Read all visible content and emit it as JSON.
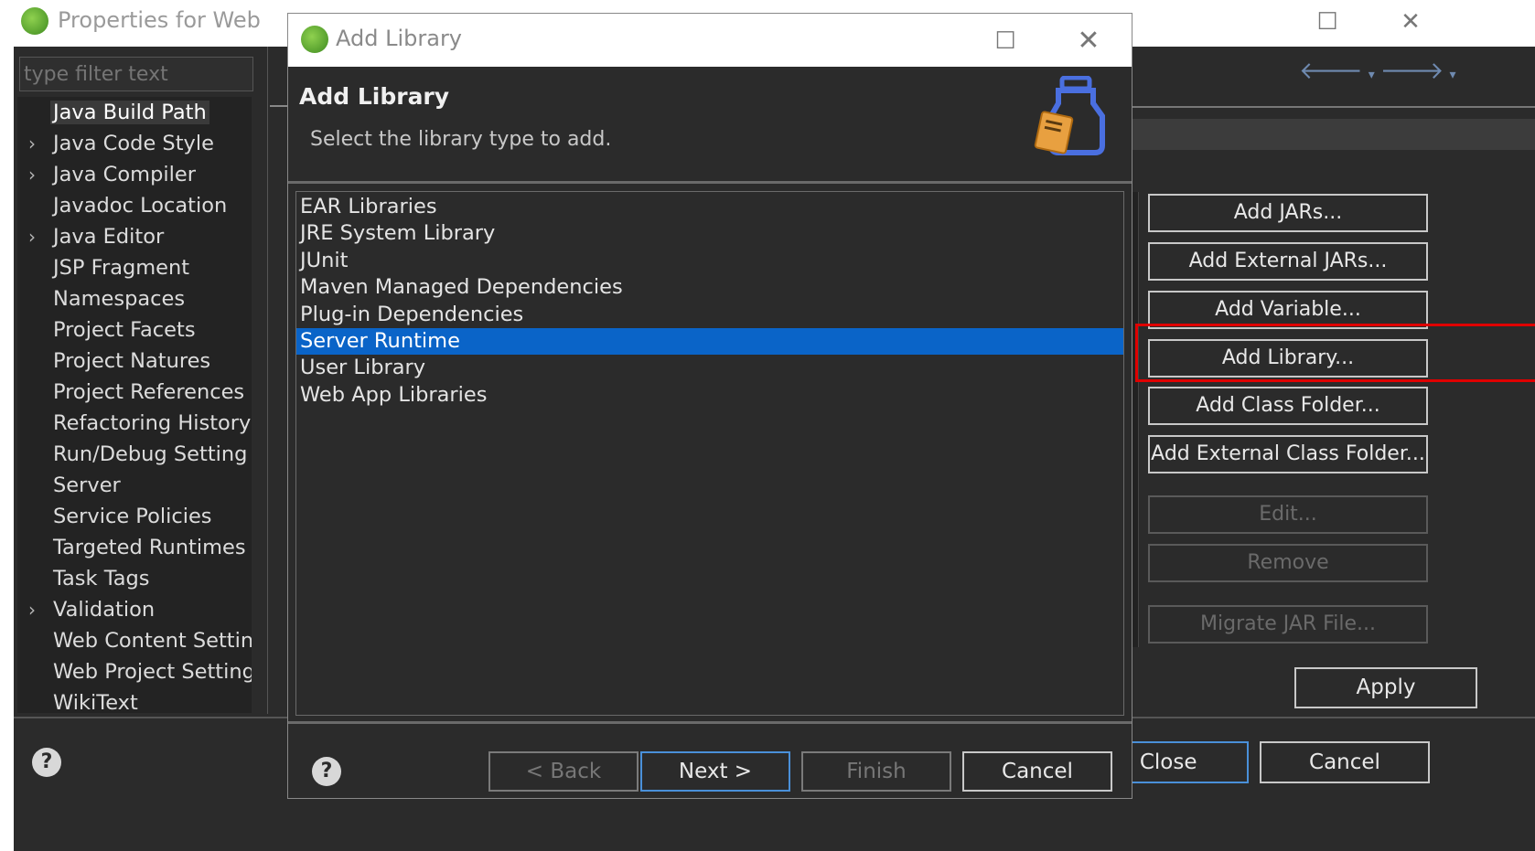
{
  "background_window": {
    "title": "Properties for Web",
    "filter": {
      "placeholder": "type filter text"
    },
    "tree_items": [
      {
        "label": "Java Build Path",
        "expandable": false,
        "selected": true
      },
      {
        "label": "Java Code Style",
        "expandable": true
      },
      {
        "label": "Java Compiler",
        "expandable": true
      },
      {
        "label": "Javadoc Location",
        "expandable": false
      },
      {
        "label": "Java Editor",
        "expandable": true
      },
      {
        "label": "JSP Fragment",
        "expandable": false
      },
      {
        "label": "Namespaces",
        "expandable": false
      },
      {
        "label": "Project Facets",
        "expandable": false
      },
      {
        "label": "Project Natures",
        "expandable": false
      },
      {
        "label": "Project References",
        "expandable": false
      },
      {
        "label": "Refactoring History",
        "expandable": false
      },
      {
        "label": "Run/Debug Setting",
        "expandable": false
      },
      {
        "label": "Server",
        "expandable": false
      },
      {
        "label": "Service Policies",
        "expandable": false
      },
      {
        "label": "Targeted Runtimes",
        "expandable": false
      },
      {
        "label": "Task Tags",
        "expandable": false
      },
      {
        "label": "Validation",
        "expandable": true
      },
      {
        "label": "Web Content Settin",
        "expandable": false
      },
      {
        "label": "Web Project Setting",
        "expandable": false
      },
      {
        "label": "WikiText",
        "expandable": false
      }
    ],
    "side_buttons": [
      {
        "label": "Add JARs...",
        "enabled": true
      },
      {
        "label": "Add External JARs...",
        "enabled": true
      },
      {
        "label": "Add Variable...",
        "enabled": true
      },
      {
        "label": "Add Library...",
        "enabled": true,
        "highlighted": true
      },
      {
        "label": "Add Class Folder...",
        "enabled": true
      },
      {
        "label": "Add External Class Folder...",
        "enabled": true
      },
      {
        "label": "Edit...",
        "enabled": false
      },
      {
        "label": "Remove",
        "enabled": false
      },
      {
        "label": "Migrate JAR File...",
        "enabled": false
      }
    ],
    "apply_label": "Apply",
    "apply_close_label": "Apply and Close",
    "cancel_label": "Cancel",
    "highlight_color": "#e00000"
  },
  "dialog": {
    "title": "Add Library",
    "heading": "Add Library",
    "subheading": "Select the library type to add.",
    "library_types": [
      {
        "label": "EAR Libraries"
      },
      {
        "label": "JRE System Library"
      },
      {
        "label": "JUnit"
      },
      {
        "label": "Maven Managed Dependencies"
      },
      {
        "label": "Plug-in Dependencies"
      },
      {
        "label": "Server Runtime",
        "selected": true
      },
      {
        "label": "User Library"
      },
      {
        "label": "Web App Libraries"
      }
    ],
    "buttons": {
      "back": "< Back",
      "next": "Next >",
      "finish": "Finish",
      "cancel": "Cancel"
    },
    "selection_color": "#0a64c8"
  }
}
